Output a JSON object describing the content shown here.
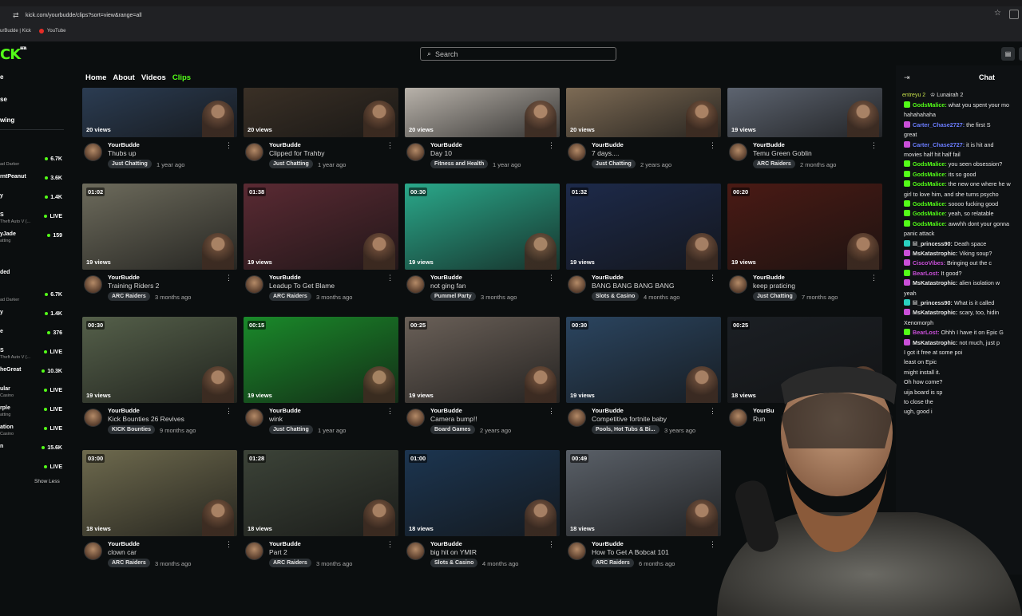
{
  "browser": {
    "url": "kick.com/yourbudde/clips?sort=view&range=all",
    "bookmarks": [
      "urBudde | Kick",
      "YouTube"
    ]
  },
  "site": {
    "logo": "CK",
    "logo_sup": "BETA",
    "search_placeholder": "Search"
  },
  "sidebar": {
    "nav": [
      "e",
      "se",
      "wing"
    ],
    "section_label": "ded",
    "show_less": "Show Less",
    "channels_top": [
      {
        "name": "",
        "sub": "ad Darker",
        "value": "6.7K"
      },
      {
        "name": "rntPeanut",
        "sub": "",
        "value": "3.6K"
      },
      {
        "name": "y",
        "sub": "",
        "value": "1.4K"
      },
      {
        "name": "S",
        "sub": "Theft Auto V (...",
        "value": "LIVE"
      },
      {
        "name": "yJade",
        "sub": "atting",
        "value": "159"
      }
    ],
    "channels_bottom": [
      {
        "name": "",
        "sub": "ad Darker",
        "value": "6.7K"
      },
      {
        "name": "y",
        "sub": "",
        "value": "1.4K"
      },
      {
        "name": "e",
        "sub": "",
        "value": "376"
      },
      {
        "name": "S",
        "sub": "Theft Auto V (...",
        "value": "LIVE"
      },
      {
        "name": "heGreat",
        "sub": "",
        "value": "10.3K"
      },
      {
        "name": "ular",
        "sub": "Casino",
        "value": "LIVE"
      },
      {
        "name": "rple",
        "sub": "atting",
        "value": "LIVE"
      },
      {
        "name": "ation",
        "sub": "Casino",
        "value": "LIVE"
      },
      {
        "name": "n",
        "sub": "",
        "value": "15.6K"
      },
      {
        "name": "",
        "sub": "",
        "value": "LIVE"
      }
    ]
  },
  "tabs": [
    "Home",
    "About",
    "Videos",
    "Clips"
  ],
  "clips": [
    [
      {
        "dur": "",
        "views": "20 views",
        "user": "YourBudde",
        "title": "Thubs up",
        "tag": "Just Chatting",
        "ago": "1 year ago",
        "bg": "#2b3c52"
      },
      {
        "dur": "",
        "views": "20 views",
        "user": "YourBudde",
        "title": "Clipped for Trahby",
        "tag": "Just Chatting",
        "ago": "1 year ago",
        "bg": "#3a3026"
      },
      {
        "dur": "",
        "views": "20 views",
        "user": "YourBudde",
        "title": "Day 10",
        "tag": "Fitness and Health",
        "ago": "1 year ago",
        "bg": "#b8b2aa"
      },
      {
        "dur": "",
        "views": "20 views",
        "user": "YourBudde",
        "title": "7 days....",
        "tag": "Just Chatting",
        "ago": "2 years ago",
        "bg": "#7d6b55"
      },
      {
        "dur": "",
        "views": "19 views",
        "user": "YourBudde",
        "title": "Temu Green Goblin",
        "tag": "ARC Raiders",
        "ago": "2 months ago",
        "bg": "#5d6470"
      }
    ],
    [
      {
        "dur": "01:02",
        "views": "19 views",
        "user": "YourBudde",
        "title": "Training Riders 2",
        "tag": "ARC Raiders",
        "ago": "3 months ago",
        "bg": "#6d6b5c"
      },
      {
        "dur": "01:38",
        "views": "19 views",
        "user": "YourBudde",
        "title": "Leadup To Get Blame",
        "tag": "ARC Raiders",
        "ago": "3 months ago",
        "bg": "#5a2a33"
      },
      {
        "dur": "00:30",
        "views": "19 views",
        "user": "YourBudde",
        "title": "not ging fan",
        "tag": "Pummel Party",
        "ago": "3 months ago",
        "bg": "#2aa88a"
      },
      {
        "dur": "01:32",
        "views": "19 views",
        "user": "YourBudde",
        "title": "BANG BANG BANG BANG",
        "tag": "Slots & Casino",
        "ago": "4 months ago",
        "bg": "#1d2a4a"
      },
      {
        "dur": "00:20",
        "views": "19 views",
        "user": "YourBudde",
        "title": "keep praticing",
        "tag": "Just Chatting",
        "ago": "7 months ago",
        "bg": "#4a1a14"
      }
    ],
    [
      {
        "dur": "00:30",
        "views": "19 views",
        "user": "YourBudde",
        "title": "Kick Bounties 26 Revives",
        "tag": "KICK Bounties",
        "ago": "9 months ago",
        "bg": "#55604a"
      },
      {
        "dur": "00:15",
        "views": "19 views",
        "user": "YourBudde",
        "title": "wink",
        "tag": "Just Chatting",
        "ago": "1 year ago",
        "bg": "#1a8a2a"
      },
      {
        "dur": "00:25",
        "views": "19 views",
        "user": "YourBudde",
        "title": "Camera bump!!",
        "tag": "Board Games",
        "ago": "2 years ago",
        "bg": "#6a6058"
      },
      {
        "dur": "00:30",
        "views": "19 views",
        "user": "YourBudde",
        "title": "Competitive fortnite baby",
        "tag": "Pools, Hot Tubs & Bi...",
        "ago": "3 years ago",
        "bg": "#2b4560"
      },
      {
        "dur": "00:25",
        "views": "18 views",
        "user": "YourBu",
        "title": "Run",
        "tag": "",
        "ago": "",
        "bg": "#1b1f24"
      }
    ],
    [
      {
        "dur": "03:00",
        "views": "18 views",
        "user": "YourBudde",
        "title": "clown car",
        "tag": "ARC Raiders",
        "ago": "3 months ago",
        "bg": "#6e6a4e"
      },
      {
        "dur": "01:28",
        "views": "18 views",
        "user": "YourBudde",
        "title": "Part 2",
        "tag": "ARC Raiders",
        "ago": "3 months ago",
        "bg": "#3c4338"
      },
      {
        "dur": "01:00",
        "views": "18 views",
        "user": "YourBudde",
        "title": "big hit on YMIR",
        "tag": "Slots & Casino",
        "ago": "4 months ago",
        "bg": "#1c3550"
      },
      {
        "dur": "00:49",
        "views": "18 views",
        "user": "YourBudde",
        "title": "How To Get A Bobcat 101",
        "tag": "ARC Raiders",
        "ago": "6 months ago",
        "bg": "#5a6068"
      }
    ]
  ],
  "chat": {
    "title": "Chat",
    "pinned": {
      "left": "entreyu 2",
      "right": "Lunairah 2"
    },
    "messages": [
      {
        "user": "GodsMalice",
        "text": "what you spent your mo",
        "color": "#53fc18",
        "badge": "#53fc18"
      },
      {
        "user": "",
        "text": "hahahahaha",
        "color": "#53fc18",
        "badge": ""
      },
      {
        "user": "Carter_Chase2727",
        "text": "the first S",
        "color": "#6b7dff",
        "badge": "#c94fd8"
      },
      {
        "user": "",
        "text": "great",
        "color": "#6b7dff",
        "badge": ""
      },
      {
        "user": "Carter_Chase2727",
        "text": "it is hit and",
        "color": "#6b7dff",
        "badge": "#c94fd8"
      },
      {
        "user": "",
        "text": "movies half hit half fail",
        "color": "#6b7dff",
        "badge": ""
      },
      {
        "user": "GodsMalice",
        "text": "you seen obsession?",
        "color": "#53fc18",
        "badge": "#53fc18"
      },
      {
        "user": "GodsMalice",
        "text": "its so good",
        "color": "#53fc18",
        "badge": "#53fc18"
      },
      {
        "user": "GodsMalice",
        "text": "the new one where he w",
        "color": "#53fc18",
        "badge": "#53fc18"
      },
      {
        "user": "",
        "text": "girl to love him, and she turns psycho",
        "color": "#53fc18",
        "badge": ""
      },
      {
        "user": "GodsMalice",
        "text": "soooo fucking good",
        "color": "#53fc18",
        "badge": "#53fc18"
      },
      {
        "user": "GodsMalice",
        "text": "yeah, so relatable",
        "color": "#53fc18",
        "badge": "#53fc18"
      },
      {
        "user": "GodsMalice",
        "text": "awwhh dont your gonna",
        "color": "#53fc18",
        "badge": "#53fc18"
      },
      {
        "user": "",
        "text": "panic attack",
        "color": "#53fc18",
        "badge": ""
      },
      {
        "user": "lil_princess90",
        "text": "Death space",
        "color": "#e6e6e6",
        "badge": "#2ad0c0"
      },
      {
        "user": "MsKatastrophic",
        "text": "Viking soup?",
        "color": "#e6e6e6",
        "badge": "#c94fd8"
      },
      {
        "user": "CiscoVibes",
        "text": "Bringing out the c",
        "color": "#c94fd8",
        "badge": "#c94fd8"
      },
      {
        "user": "BearLost",
        "text": "It good?",
        "color": "#c94fd8",
        "badge": "#53fc18"
      },
      {
        "user": "MsKatastrophic",
        "text": "alien isolation w",
        "color": "#e6e6e6",
        "badge": "#c94fd8"
      },
      {
        "user": "",
        "text": "yeah",
        "color": "#e6e6e6",
        "badge": ""
      },
      {
        "user": "lil_princess90",
        "text": "What is it called",
        "color": "#e6e6e6",
        "badge": "#2ad0c0"
      },
      {
        "user": "MsKatastrophic",
        "text": "scary, too, hidin",
        "color": "#e6e6e6",
        "badge": "#c94fd8"
      },
      {
        "user": "",
        "text": "Xenomorph",
        "color": "#e6e6e6",
        "badge": ""
      },
      {
        "user": "BearLost",
        "text": "Ohhh I have it on Epic G",
        "color": "#c94fd8",
        "badge": "#53fc18"
      },
      {
        "user": "MsKatastrophic",
        "text": "not much, just p",
        "color": "#e6e6e6",
        "badge": "#c94fd8"
      },
      {
        "user": "",
        "text": "I got it free at some poi",
        "color": "#e6e6e6",
        "badge": ""
      },
      {
        "user": "",
        "text": "least on Epic",
        "color": "#e6e6e6",
        "badge": ""
      },
      {
        "user": "",
        "text": "might install it.",
        "color": "#e6e6e6",
        "badge": ""
      },
      {
        "user": "",
        "text": "Oh how come?",
        "color": "#e6e6e6",
        "badge": ""
      },
      {
        "user": "",
        "text": "uija board is sp",
        "color": "#e6e6e6",
        "badge": ""
      },
      {
        "user": "",
        "text": "to close the",
        "color": "#e6e6e6",
        "badge": ""
      },
      {
        "user": "",
        "text": "ugh, good i",
        "color": "#e6e6e6",
        "badge": ""
      }
    ]
  },
  "colors": {
    "accent": "#53fc18",
    "bg": "#0b0e0f",
    "chip": "#2c3135"
  }
}
